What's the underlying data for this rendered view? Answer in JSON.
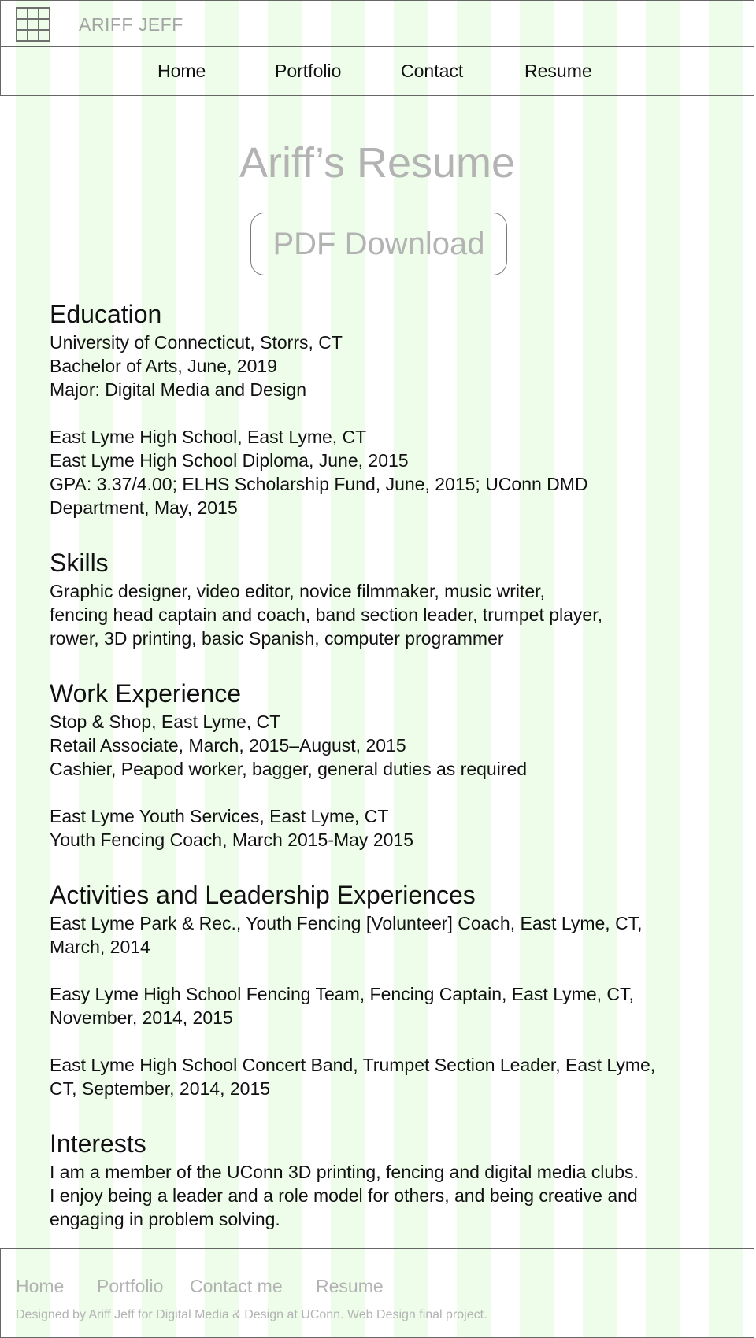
{
  "header": {
    "brand": "ARIFF JEFF",
    "icon": "grid-icon"
  },
  "nav": {
    "items": [
      "Home",
      "Portfolio",
      "Contact",
      "Resume"
    ]
  },
  "main": {
    "title": "Ariff’s Resume",
    "pdf_button": "PDF Download"
  },
  "sections": {
    "education": {
      "title": "Education",
      "lines": [
        "University of Connecticut, Storrs, CT",
        "Bachelor of Arts, June, 2019",
        "Major: Digital Media and Design",
        "East Lyme High School, East Lyme, CT",
        "East Lyme High School Diploma, June, 2015",
        "GPA: 3.37/4.00; ELHS Scholarship Fund, June, 2015; UConn DMD",
        "Department, May, 2015"
      ]
    },
    "skills": {
      "title": "Skills",
      "lines": [
        "Graphic designer, video editor, novice filmmaker, music writer,",
        "fencing head captain and coach, band section leader, trumpet player,",
        "rower, 3D printing, basic Spanish, computer programmer"
      ]
    },
    "work": {
      "title": "Work Experience",
      "lines": [
        "Stop & Shop, East Lyme, CT",
        "Retail Associate, March, 2015–August, 2015",
        "Cashier, Peapod worker, bagger, general duties as required",
        "East Lyme Youth Services, East Lyme, CT",
        "Youth Fencing Coach, March 2015-May 2015"
      ]
    },
    "activities": {
      "title": "Activities and Leadership Experiences",
      "lines": [
        "East Lyme Park & Rec., Youth Fencing [Volunteer] Coach, East Lyme, CT,",
        "March, 2014",
        "Easy Lyme High School Fencing Team, Fencing Captain, East Lyme, CT,",
        "November, 2014, 2015",
        "East Lyme High School Concert Band, Trumpet Section Leader, East Lyme,",
        "CT, September, 2014, 2015"
      ]
    },
    "interests": {
      "title": "Interests",
      "lines": [
        "I am a member of the UConn 3D printing, fencing and digital media clubs.",
        "I enjoy being a leader and a role model for others, and being creative and",
        "engaging in problem solving."
      ]
    }
  },
  "footer": {
    "links": [
      "Home",
      "Portfolio",
      "Contact me",
      "Resume"
    ],
    "note": "Designed by Ariff Jeff for Digital Media & Design at UConn. Web Design final project."
  }
}
